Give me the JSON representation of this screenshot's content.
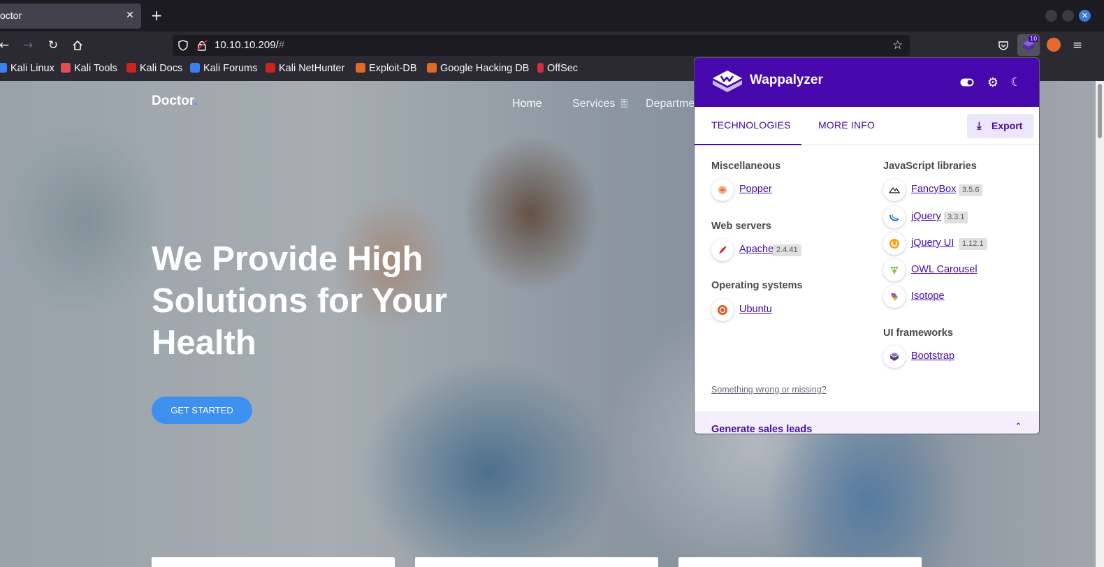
{
  "browser": {
    "tab_title": "octor",
    "tab_close": "✕",
    "new_tab": "+",
    "url_host": "10.10.10.209/",
    "url_hash": "#",
    "extension_badge": "10",
    "bookmarks": [
      {
        "label": "Kali Linux",
        "color": "#3a80f0"
      },
      {
        "label": "Kali Tools",
        "color": "#e05050"
      },
      {
        "label": "Kali Docs",
        "color": "#cc2222"
      },
      {
        "label": "Kali Forums",
        "color": "#3a80f0"
      },
      {
        "label": "Kali NetHunter",
        "color": "#cc2222"
      },
      {
        "label": "Exploit-DB",
        "color": "#e06a2a"
      },
      {
        "label": "Google Hacking DB",
        "color": "#e06a2a"
      },
      {
        "label": "OffSec",
        "color": "#d03040"
      }
    ]
  },
  "site": {
    "brand": "Doctor",
    "brand_dot": ".",
    "menu": {
      "home": "Home",
      "services": "Services",
      "services_icon": "🎚",
      "departments": "Departme"
    },
    "hero_title": "We Provide High Solutions for Your Health",
    "cta": "GET STARTED"
  },
  "wappalyzer": {
    "name": "Wappalyzer",
    "brand_color": "#4608ad",
    "tabs": {
      "technologies": "TECHNOLOGIES",
      "more_info": "MORE INFO"
    },
    "export": "Export",
    "left_categories": [
      {
        "title": "Miscellaneous",
        "items": [
          {
            "name": "Popper",
            "version": ""
          }
        ]
      },
      {
        "title": "Web servers",
        "items": [
          {
            "name": "Apache",
            "version": "2.4.41"
          }
        ]
      },
      {
        "title": "Operating systems",
        "items": [
          {
            "name": "Ubuntu",
            "version": ""
          }
        ]
      }
    ],
    "right_categories": [
      {
        "title": "JavaScript libraries",
        "items": [
          {
            "name": "FancyBox",
            "version": "3.5.6"
          },
          {
            "name": "jQuery",
            "version": "3.3.1"
          },
          {
            "name": "jQuery UI",
            "version": "1.12.1"
          },
          {
            "name": "OWL Carousel",
            "version": ""
          },
          {
            "name": "Isotope",
            "version": ""
          }
        ]
      },
      {
        "title": "UI frameworks",
        "items": [
          {
            "name": "Bootstrap",
            "version": ""
          }
        ]
      }
    ],
    "report_link": "Something wrong or missing?",
    "footer_title": "Generate sales leads",
    "footer_chevron": "⌃"
  }
}
